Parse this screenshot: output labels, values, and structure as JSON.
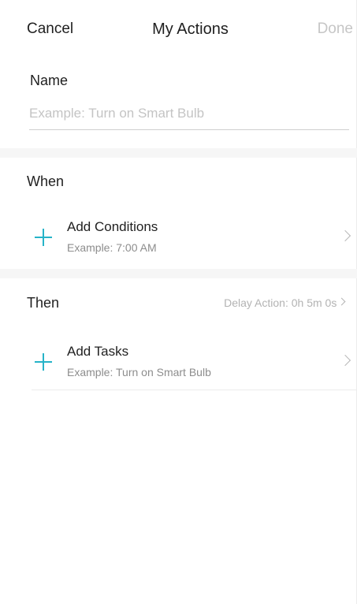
{
  "nav": {
    "cancel_label": "Cancel",
    "title": "My Actions",
    "done_label": "Done"
  },
  "name_section": {
    "label": "Name",
    "input_value": "",
    "placeholder": "Example: Turn on Smart Bulb"
  },
  "when_section": {
    "title": "When",
    "add_conditions": {
      "title": "Add Conditions",
      "subtitle": "Example: 7:00 AM",
      "icon": "plus-icon"
    }
  },
  "then_section": {
    "title": "Then",
    "delay_label": "Delay Action: 0h 5m 0s",
    "add_tasks": {
      "title": "Add Tasks",
      "subtitle": "Example: Turn on Smart Bulb",
      "icon": "plus-icon"
    }
  },
  "colors": {
    "accent": "#26b3c8",
    "disabled_text": "#c6c6c6",
    "secondary_text": "#8d8d8d",
    "section_gap": "#f6f6f6"
  }
}
